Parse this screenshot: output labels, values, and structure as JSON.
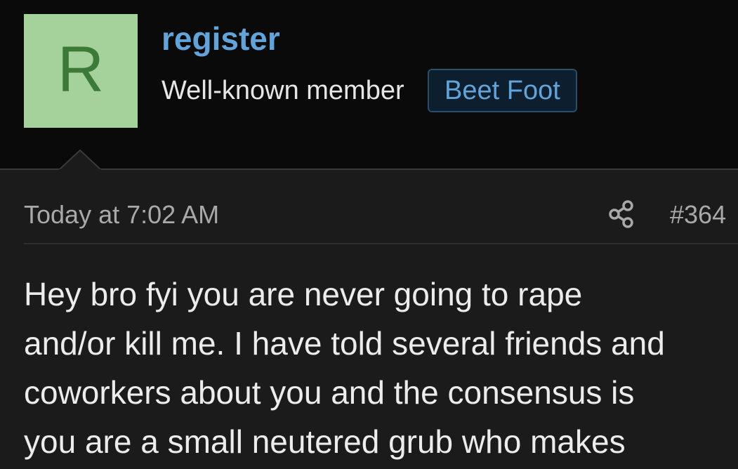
{
  "user": {
    "avatar_letter": "R",
    "avatar_color": "#a5d29a",
    "name": "register",
    "title": "Well-known member",
    "badge": "Beet Foot"
  },
  "post": {
    "date": "Today at 7:02 AM",
    "share_icon": "share-icon",
    "number": "#364",
    "lines": [
      "Hey bro fyi you are never going to rape",
      "and/or kill me. I have told several friends and",
      "coworkers about you and the consensus is",
      "you are a small neutered grub who makes"
    ]
  },
  "colors": {
    "accent": "#62a3d9",
    "background": "#0a0a0a",
    "post_background": "#1b1b1b"
  }
}
